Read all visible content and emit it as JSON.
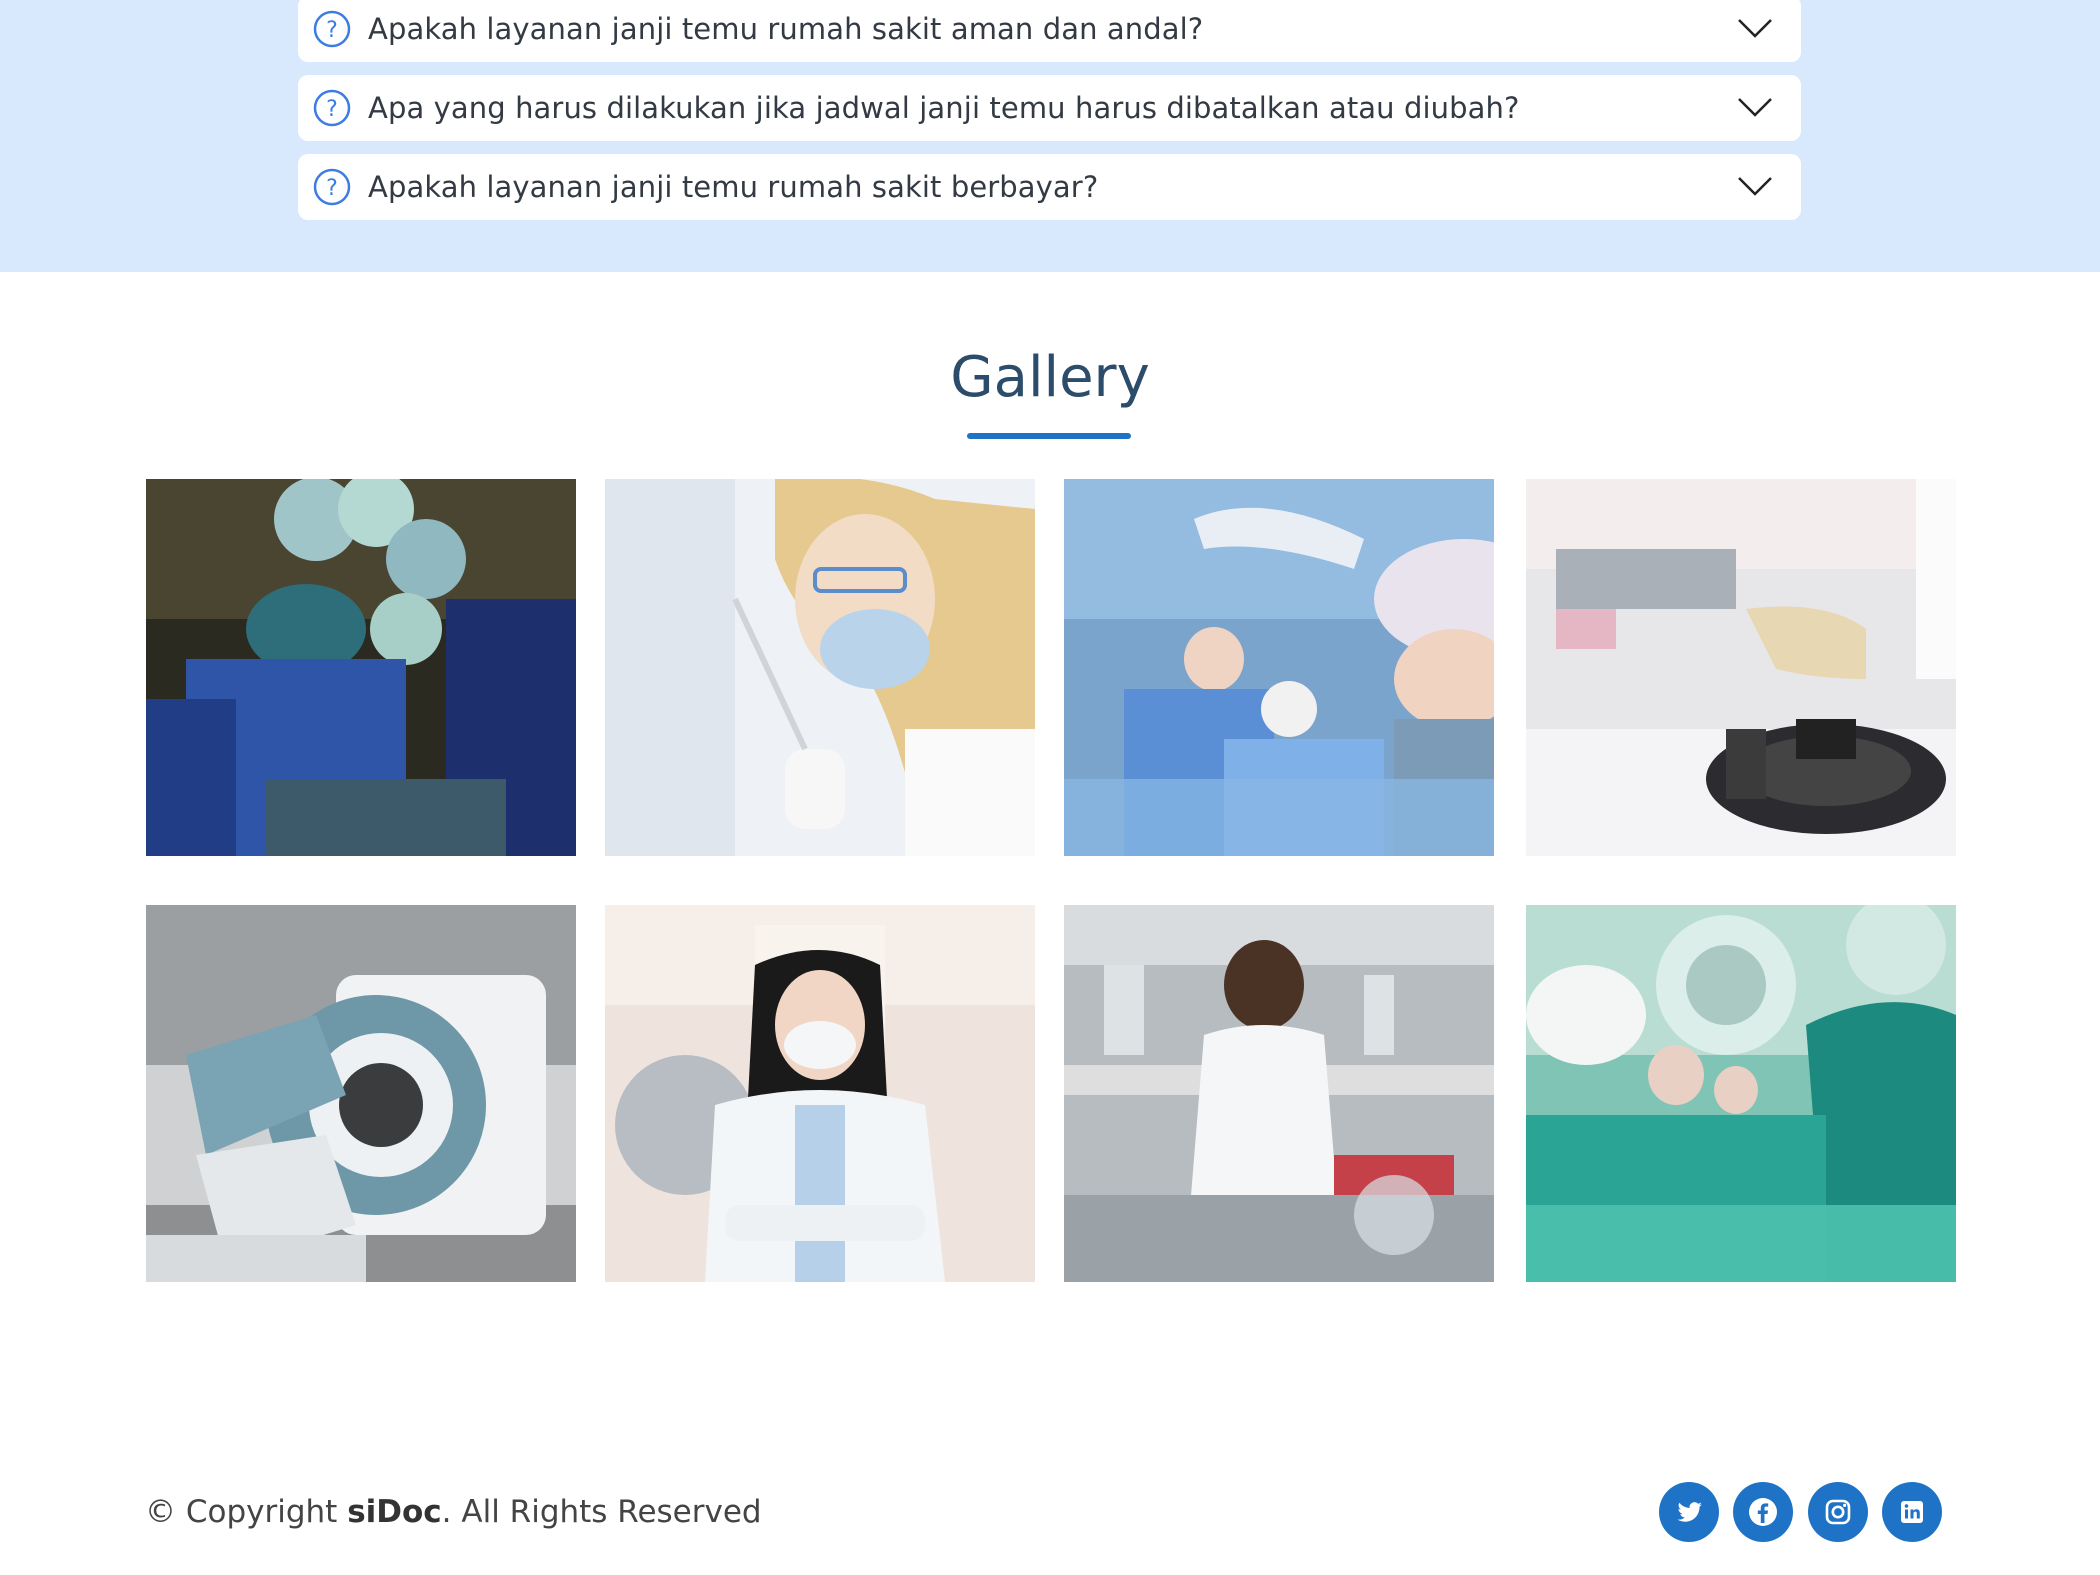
{
  "faq": {
    "items": [
      {
        "question": "Apakah layanan janji temu rumah sakit aman dan andal?"
      },
      {
        "question": "Apa yang harus dilakukan jika jadwal janji temu harus dibatalkan atau diubah?"
      },
      {
        "question": "Apakah layanan janji temu rumah sakit berbayar?"
      }
    ],
    "question_icon": "question-circle-icon",
    "expand_icon": "chevron-down-icon"
  },
  "gallery": {
    "title": "Gallery",
    "images": [
      {
        "subject": "surgeons under operating lights"
      },
      {
        "subject": "scientist with safety glasses and pipette"
      },
      {
        "subject": "surgical team in operating room"
      },
      {
        "subject": "lab centrifuge with test tube"
      },
      {
        "subject": "medical scanner machine"
      },
      {
        "subject": "doctor wearing mask in hospital corridor"
      },
      {
        "subject": "researcher in laboratory"
      },
      {
        "subject": "surgeons under surgical lamp"
      }
    ]
  },
  "footer": {
    "copyright_prefix": "© Copyright ",
    "brand": "siDoc",
    "copyright_suffix": ". All Rights Reserved",
    "social": [
      {
        "icon": "twitter-icon"
      },
      {
        "icon": "facebook-icon"
      },
      {
        "icon": "instagram-icon"
      },
      {
        "icon": "linkedin-icon"
      }
    ]
  },
  "colors": {
    "faq_background": "#d9e9fd",
    "accent": "#1f73c7",
    "title": "#2c4c6b"
  }
}
